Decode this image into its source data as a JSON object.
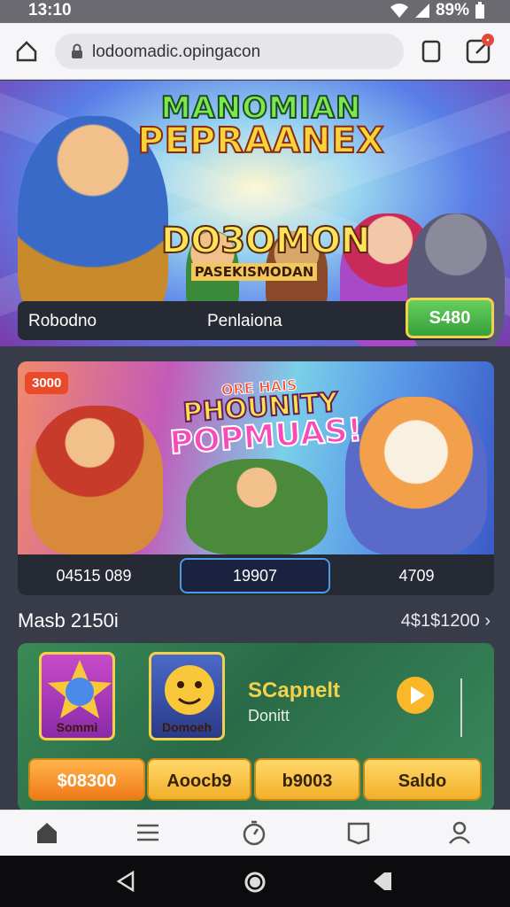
{
  "status_bar": {
    "time": "13:10",
    "battery": "89%"
  },
  "browser": {
    "url": "lodoomadic.opingacon"
  },
  "hero": {
    "title_line1": "MANOMIAN",
    "title_line2": "PEPRAANEX",
    "logo_big": "DO3OMON",
    "logo_small": "PASEKISMODAN",
    "info_left": "Robodno",
    "info_mid": "Penlaiona",
    "price_button": "S480"
  },
  "promo": {
    "badge": "3000",
    "title_line1": "ORE HAIS",
    "title_line2": "PHOUNITY",
    "title_line3": "POPMUAS!",
    "stats": [
      "04515 089",
      "19907",
      "4709"
    ]
  },
  "section": {
    "title": "Masb 2150i",
    "link": "4$1$1200"
  },
  "games": {
    "tile1_label": "Sommi",
    "tile2_label": "Domoeh",
    "name": "SCapnelt",
    "subtitle": "Donitt",
    "buttons": [
      "$08300",
      "Aoocb9",
      "b9003",
      "Saldo"
    ]
  },
  "colors": {
    "accent_green": "#36a03a",
    "accent_gold": "#f2b02a",
    "dark_panel": "#262a34"
  }
}
